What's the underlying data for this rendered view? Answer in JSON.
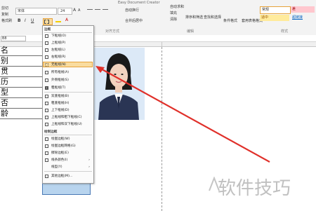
{
  "ribbon": {
    "paste_label": "粘贴",
    "cut_label": "剪切",
    "copy_label": "复制",
    "format_painter_label": "格式刷",
    "font_name": "宋体",
    "font_size": "24",
    "wrap_text": "自动换行",
    "merge_center": "合并后居中",
    "autosum": "自动求和",
    "fill": "填充",
    "clear": "清除",
    "sort_filter": "排序和筛选",
    "find_select": "查找和选择",
    "cond_format": "条件格式",
    "format_table": "套用表格格式",
    "style_normal": "常规",
    "style_bad": "差",
    "style_neutral": "适中",
    "style_link": "超链接",
    "group_alignment": "对齐方式",
    "group_editing": "编辑",
    "group_styles": "样式",
    "title_fragment": "Easy Document Creator"
  },
  "name_box": "B8",
  "sheet": {
    "row_chars": [
      "名",
      "别",
      "贯",
      "历",
      "型",
      "否",
      "龄"
    ]
  },
  "menu": {
    "header_borders": "边框",
    "items": [
      "下框线(O)",
      "上框线(P)",
      "左框线(L)",
      "右框线(R)",
      "无框线(N)",
      "所有框线(A)",
      "外侧框线(S)",
      "粗框线(T)",
      "双底框线(B)",
      "粗底框线(H)",
      "上下框线(D)",
      "上框线和粗下框线(C)",
      "上框线和双下框线(U)"
    ],
    "header_draw": "绘制边框",
    "draw_items": [
      "绘图边框(W)",
      "绘图边框网格(G)",
      "擦除边框(E)",
      "线条颜色(I)",
      "线型(Y)",
      "其他边框(M)..."
    ],
    "selected_item": "无框线(N)"
  },
  "watermark": "软件技巧",
  "colors": {
    "menu_highlight": "#f9dc9f",
    "arrow": "#e0302a",
    "selection": "#b8d4ee",
    "photo_bg": "#d9e8f7"
  }
}
